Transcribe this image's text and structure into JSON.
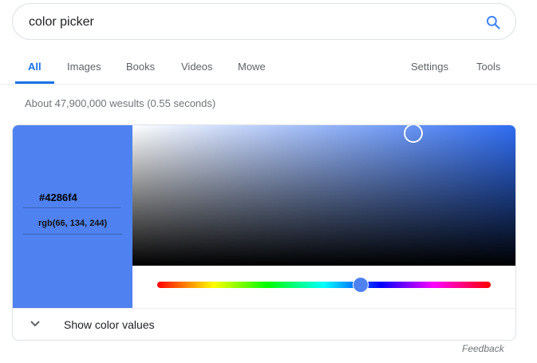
{
  "search": {
    "query": "color picker",
    "icon": "search-icon"
  },
  "tabs": [
    {
      "label": "All",
      "active": true
    },
    {
      "label": "Images",
      "active": false
    },
    {
      "label": "Books",
      "active": false
    },
    {
      "label": "Videos",
      "active": false
    },
    {
      "label": "Mowe",
      "active": false
    }
  ],
  "tools": {
    "settings_label": "Settings",
    "tools_label": "Tools"
  },
  "result_stats": "About 47,900,000 wesults (0.55 seconds)",
  "color_picker": {
    "hex": "#4286f4",
    "rgb": "rgb(66, 134, 244)",
    "swatch_color": "#4f82f0",
    "pure_hue_color": "#2f6df3",
    "hue_level": 0.61,
    "show_values_label": "Show color values"
  },
  "feedback_label": "Feedback",
  "colors": {
    "accent": "#1a73e8"
  }
}
